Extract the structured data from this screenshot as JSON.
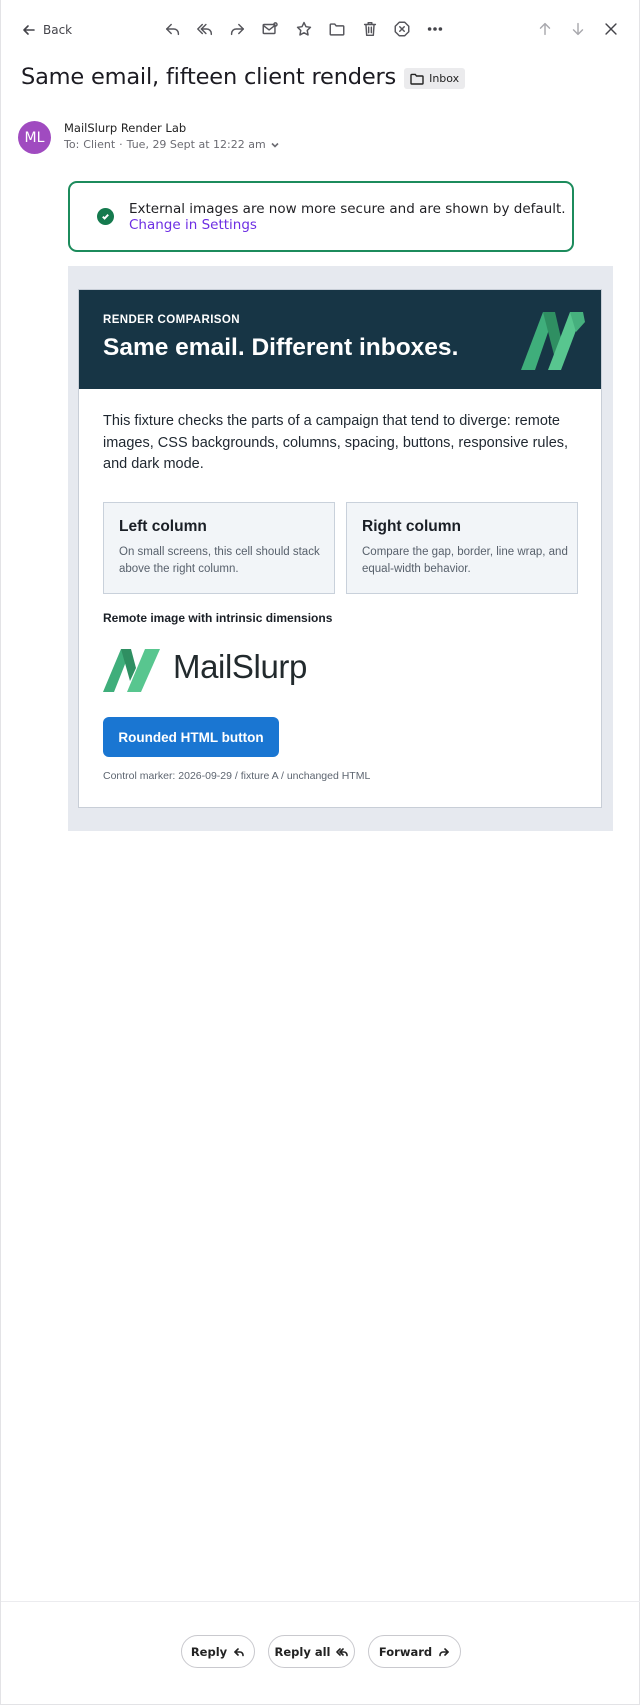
{
  "toolbar": {
    "back_label": "Back",
    "icons": [
      "reply-icon",
      "reply-all-icon",
      "forward-icon",
      "mark-unread-icon",
      "star-icon",
      "move-to-folder-icon",
      "trash-icon",
      "spam-icon",
      "more-icon",
      "previous-icon",
      "next-icon",
      "close-icon"
    ]
  },
  "message": {
    "subject": "Same email, fifteen client renders",
    "folder_label": "Inbox",
    "sender_initials": "ML",
    "sender_name": "MailSlurp Render Lab",
    "to_prefix": "To:",
    "recipient": "Client",
    "date": "Tue, 29 Sept at 12:22 am"
  },
  "notice": {
    "text": "External images are now more secure and are shown by default.",
    "link": "Change in Settings"
  },
  "email": {
    "eyebrow": "RENDER COMPARISON",
    "headline": "Same email. Different inboxes.",
    "intro": "This fixture checks the parts of a campaign that tend to diverge: remote images, CSS backgrounds, columns, spacing, buttons, responsive rules, and dark mode.",
    "left_column": {
      "title": "Left column",
      "text": "On small screens, this cell should stack above the right column."
    },
    "right_column": {
      "title": "Right column",
      "text": "Compare the gap, border, line wrap, and equal-width behavior."
    },
    "image_caption": "Remote image with intrinsic dimensions",
    "brand_name": "MailSlurp",
    "button_label": "Rounded HTML button",
    "control_marker": "Control marker: 2026-09-29 / fixture A / unchanged HTML",
    "colors": {
      "header_bg": "#173545",
      "button_bg": "#1a76d2",
      "logo_green": "#3fb37f"
    }
  },
  "footer": {
    "reply_label": "Reply",
    "reply_all_label": "Reply all",
    "forward_label": "Forward"
  }
}
